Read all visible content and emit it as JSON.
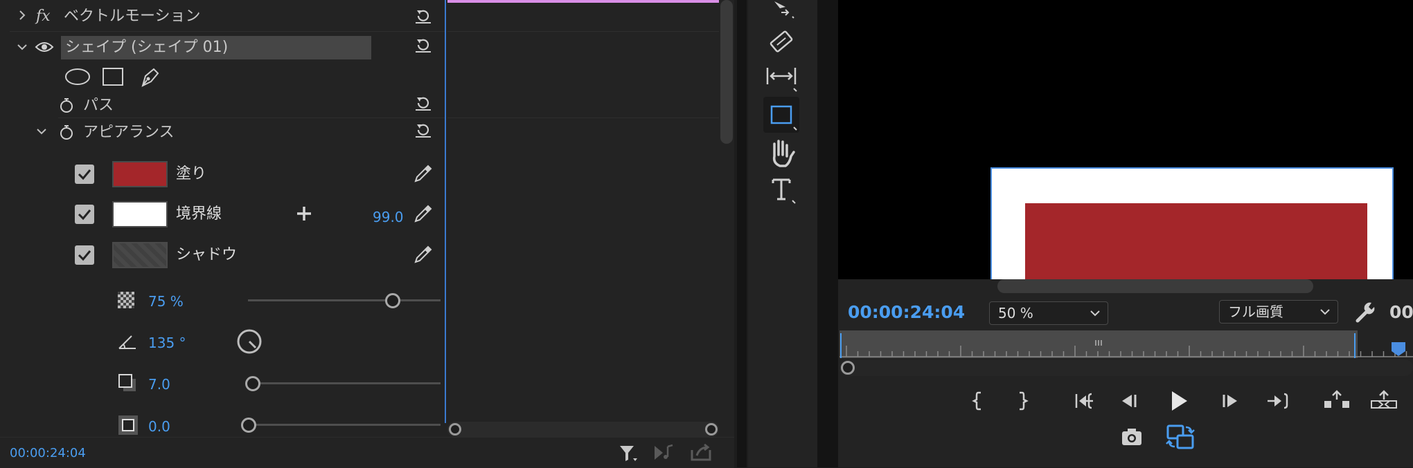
{
  "effects": {
    "vector_motion_label": "ベクトルモーション",
    "fx_label": "fx",
    "shape_name": "シェイプ (シェイプ 01)",
    "path_label": "パス",
    "appearance_label": "アピアランス",
    "fill_label": "塗り",
    "fill_color": "#a4262a",
    "stroke_label": "境界線",
    "stroke_color": "#ffffff",
    "stroke_width": "99.0",
    "shadow_label": "シャドウ",
    "shadow_opacity": "75 %",
    "shadow_angle": "135 °",
    "shadow_distance": "7.0",
    "shadow_size": "0.0",
    "shadow_opacity_level": 0.75
  },
  "effect_controls_timecode": "00:00:24:04",
  "program": {
    "timecode": "00:00:24:04",
    "zoom": "50 %",
    "quality": "フル画質",
    "right_timecode_partial": "00",
    "rect_fill": "#a4262a"
  },
  "colors": {
    "accent": "#4a9df0",
    "timeline_bar": "#d98ee6"
  }
}
